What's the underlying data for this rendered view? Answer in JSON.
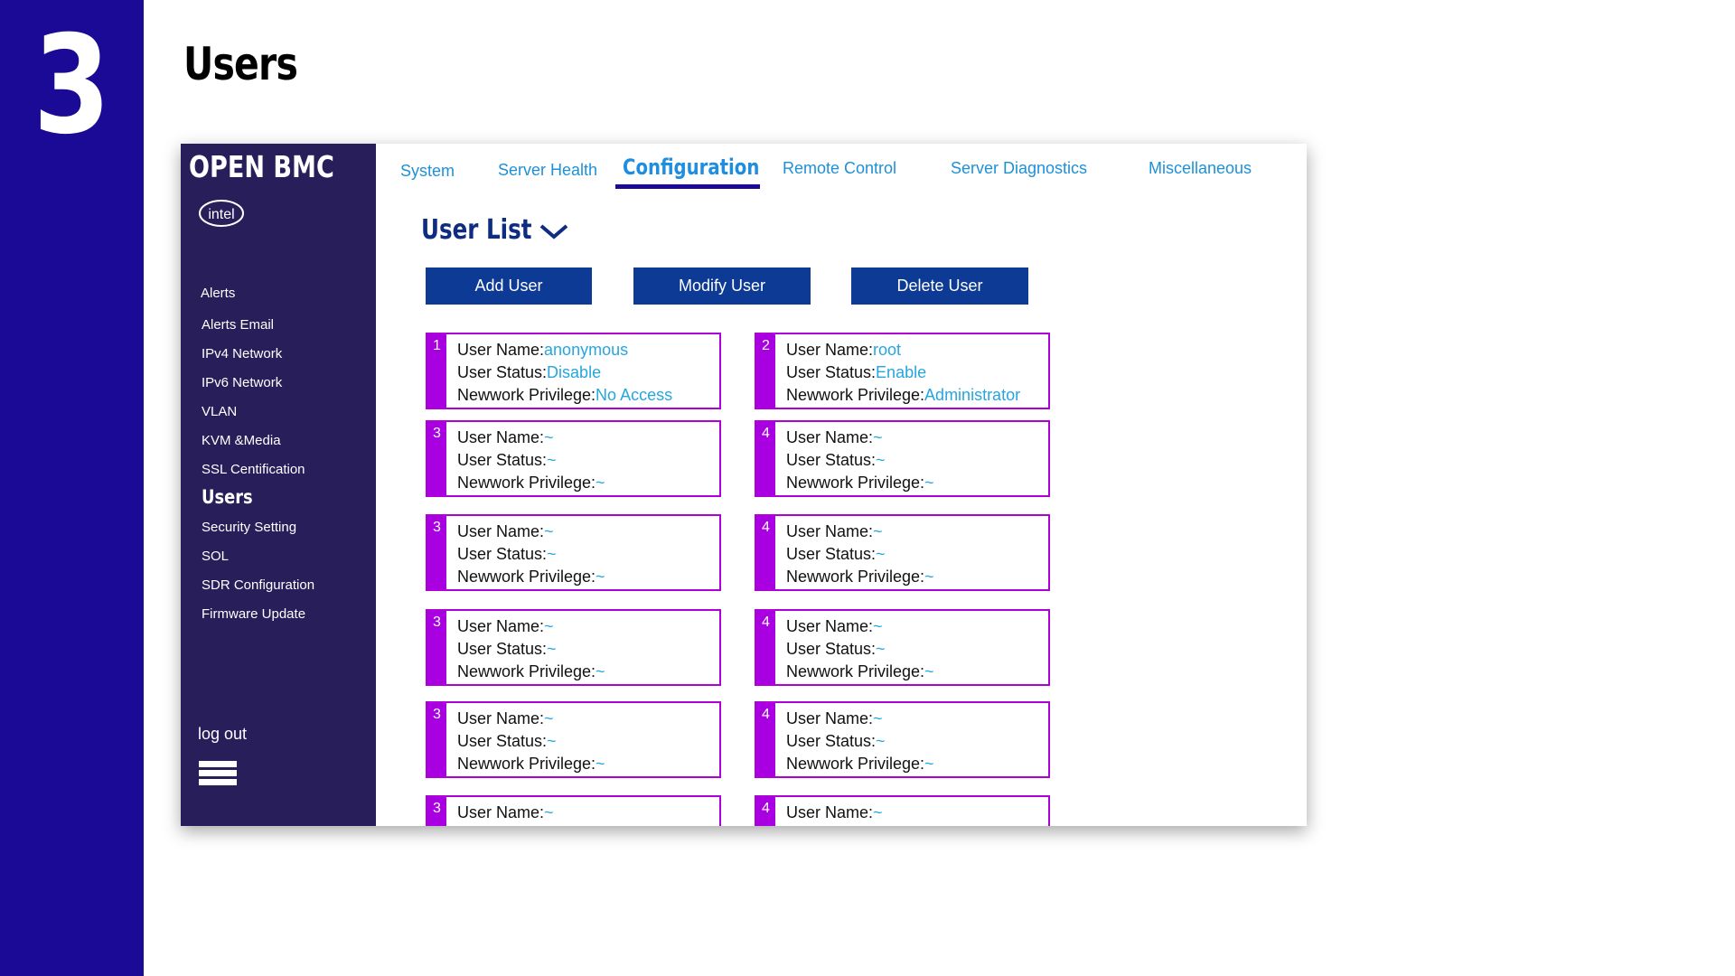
{
  "slide": {
    "number": "3",
    "title": "Users"
  },
  "app": {
    "brand": "OPEN BMC",
    "logo": "intel",
    "sidebar": {
      "heading": "Alerts",
      "items": [
        {
          "label": "Alerts Email"
        },
        {
          "label": "IPv4 Network"
        },
        {
          "label": "IPv6 Network"
        },
        {
          "label": "VLAN"
        },
        {
          "label": "KVM &Media"
        },
        {
          "label": "SSL Centification"
        },
        {
          "label": "Users",
          "active": true
        },
        {
          "label": "Security Setting"
        },
        {
          "label": "SOL"
        },
        {
          "label": "SDR Configuration"
        },
        {
          "label": "Firmware Update"
        }
      ],
      "logout": "log out",
      "menu_icon": "hamburger-icon"
    },
    "tabs": [
      {
        "label": "System"
      },
      {
        "label": "Server Health"
      },
      {
        "label": "Configuration",
        "active": true
      },
      {
        "label": "Remote Control"
      },
      {
        "label": "Server Diagnostics"
      },
      {
        "label": "Miscellaneous"
      }
    ],
    "section": {
      "title": "User List",
      "icon": "chevron-down-icon"
    },
    "buttons": {
      "add": "Add User",
      "modify": "Modify User",
      "delete": "Delete User"
    },
    "field_labels": {
      "name": "User Name:",
      "status": "User Status:",
      "privilege": "Newwork Privilege:"
    },
    "users": [
      {
        "id": "1",
        "name": "anonymous",
        "status": "Disable",
        "privilege": "No Access"
      },
      {
        "id": "2",
        "name": "root",
        "status": "Enable",
        "privilege": "Administrator"
      },
      {
        "id": "3",
        "name": "~",
        "status": "~",
        "privilege": "~"
      },
      {
        "id": "4",
        "name": "~",
        "status": "~",
        "privilege": "~"
      },
      {
        "id": "3",
        "name": "~",
        "status": "~",
        "privilege": "~"
      },
      {
        "id": "4",
        "name": "~",
        "status": "~",
        "privilege": "~"
      },
      {
        "id": "3",
        "name": "~",
        "status": "~",
        "privilege": "~"
      },
      {
        "id": "4",
        "name": "~",
        "status": "~",
        "privilege": "~"
      },
      {
        "id": "3",
        "name": "~",
        "status": "~",
        "privilege": "~"
      },
      {
        "id": "4",
        "name": "~",
        "status": "~",
        "privilege": "~"
      },
      {
        "id": "3",
        "name": "~",
        "status": "~",
        "privilege": "~"
      },
      {
        "id": "4",
        "name": "~",
        "status": "~",
        "privilege": "~"
      }
    ],
    "colors": {
      "slide_accent": "#1a0a96",
      "sidebar_bg": "#281e5a",
      "tab_text": "#1e90d8",
      "button_bg": "#0d3a94",
      "card_border": "#b000d8",
      "value_text": "#25a6e0"
    }
  }
}
